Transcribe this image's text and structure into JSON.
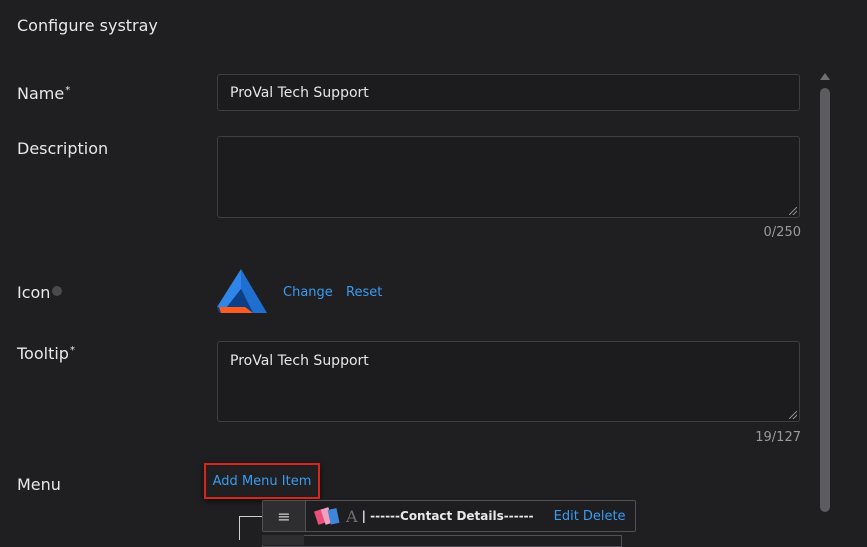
{
  "page": {
    "title": "Configure systray"
  },
  "fields": {
    "name": {
      "label": "Name",
      "required_mark": "*",
      "value": "ProVal Tech Support"
    },
    "description": {
      "label": "Description",
      "value": "",
      "counter": "0/250"
    },
    "icon": {
      "label": "Icon",
      "change_label": "Change",
      "reset_label": "Reset"
    },
    "tooltip": {
      "label": "Tooltip",
      "required_mark": "*",
      "value": "ProVal Tech Support",
      "counter": "19/127"
    },
    "menu": {
      "label": "Menu",
      "add_button_label": "Add Menu Item"
    }
  },
  "menu_items": [
    {
      "handle_icon": "≡",
      "text": "| ------Contact Details------",
      "edit_label": "Edit",
      "delete_label": "Delete"
    }
  ],
  "colors": {
    "accent": "#3c9bf0",
    "highlight_border": "#d9261c",
    "background": "#1f1f21"
  }
}
